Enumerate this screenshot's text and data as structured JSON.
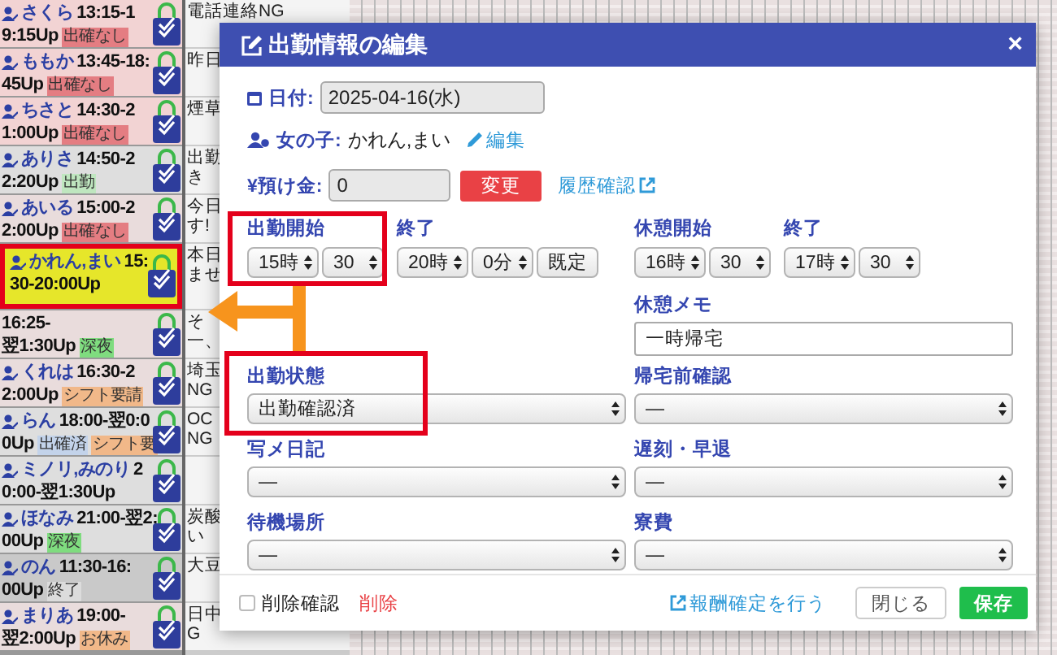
{
  "staff": [
    {
      "name": "さくら",
      "time1": "13:15-1",
      "time2": "9:15Up",
      "color": "#f2d3d3",
      "selected": false,
      "tags": [
        {
          "label": "出確なし",
          "color": "#e47d82"
        }
      ],
      "notes": [
        "電話連絡NG"
      ]
    },
    {
      "name": "ももか",
      "time1": "13:45-18:",
      "time2": "45Up",
      "color": "#f2d3d3",
      "selected": false,
      "tags": [
        {
          "label": "出確なし",
          "color": "#e47d82"
        }
      ],
      "notes": [
        "昨日"
      ]
    },
    {
      "name": "ちさと",
      "time1": "14:30-2",
      "time2": "1:00Up",
      "color": "#f2d3d3",
      "selected": false,
      "tags": [
        {
          "label": "出確なし",
          "color": "#e47d82"
        }
      ],
      "notes": [
        "煙草"
      ]
    },
    {
      "name": "ありさ",
      "time1": "14:50-2",
      "time2": "2:20Up",
      "color": "#dedede",
      "selected": false,
      "tags": [
        {
          "label": "出勤",
          "color": "#bfe6bf"
        }
      ],
      "notes": [
        "出勤",
        "き"
      ]
    },
    {
      "name": "あいる",
      "time1": "15:00-2",
      "time2": "2:00Up",
      "color": "#e9dcdc",
      "selected": false,
      "tags": [
        {
          "label": "出確なし",
          "color": "#e47d82"
        }
      ],
      "notes": [
        "今日",
        "す!"
      ]
    },
    {
      "name": "かれん,まい",
      "time1": "15:",
      "time2": "30-20:00Up",
      "color": "#e6e62a",
      "selected": true,
      "notes": [
        "本日",
        "ませ"
      ]
    },
    {
      "time1": "16:25-",
      "time2": "翌1:30Up",
      "color": "#e9dcdc",
      "selected": false,
      "tags": [
        {
          "label": "深夜",
          "color": "#7fdc7f"
        }
      ],
      "notes": [
        "そ",
        "一、"
      ]
    },
    {
      "name": "くれは",
      "time1": "16:30-2",
      "time2": "2:00Up",
      "color": "#e9dcdc",
      "selected": false,
      "tags": [
        {
          "label": "シフト要請",
          "color": "#f1b889"
        }
      ],
      "notes": [
        "埼玉",
        "NG"
      ]
    },
    {
      "name": "らん",
      "time1": "18:00-翌0:0",
      "time2": "0Up",
      "color": "#dedede",
      "selected": false,
      "tags": [
        {
          "label": "出確済",
          "color": "#c3d3ea"
        },
        {
          "label": "シフト要",
          "color": "#f1b889"
        }
      ],
      "notes": [
        "OC",
        "NG"
      ]
    },
    {
      "name": "ミノリ,みのり",
      "time1": "2",
      "time2": "0:00-翌1:30Up",
      "color": "#dedede",
      "selected": false
    },
    {
      "name": "ほなみ",
      "time1": "21:00-翌2:",
      "time2": "00Up",
      "color": "#dedede",
      "selected": false,
      "tags": [
        {
          "label": "深夜",
          "color": "#7fdc7f"
        }
      ],
      "notes": [
        "炭酸",
        "い"
      ]
    },
    {
      "name": "のん",
      "time1": "11:30-16:",
      "time2": "00Up",
      "color": "#c9c9c9",
      "selected": false,
      "tags": [
        {
          "label": "終了",
          "color": "#dcdcdc"
        }
      ],
      "notes": [
        "大豆"
      ]
    },
    {
      "name": "まりあ",
      "time1": "19:00-",
      "time2": "翌2:00Up",
      "color": "#e9dcdc",
      "selected": false,
      "tags": [
        {
          "label": "お休み",
          "color": "#f1b889"
        }
      ],
      "notes": [
        "日中",
        "G"
      ]
    }
  ],
  "modal": {
    "title": "出勤情報の編集",
    "close": "×",
    "date": {
      "label": "日付:",
      "value": "2025-04-16(水)"
    },
    "girl": {
      "label": "女の子:",
      "value": "かれん,まい",
      "edit_link": "編集"
    },
    "deposit": {
      "label": "¥預け金:",
      "value": "0",
      "button": "変更",
      "history_link": "履歴確認"
    },
    "time_groups": [
      {
        "label": "出勤開始",
        "selects": [
          "15時",
          "30"
        ]
      },
      {
        "label": "終了",
        "selects": [
          "20時",
          "0分",
          "既定"
        ]
      },
      {
        "label": "休憩開始",
        "selects": [
          "16時",
          "30"
        ]
      },
      {
        "label": "終了",
        "selects": [
          "17時",
          "30"
        ]
      }
    ],
    "break_memo": {
      "label": "休憩メモ",
      "value": "一時帰宅"
    },
    "fields": [
      {
        "label": "出勤状態",
        "value": "出勤確認済"
      },
      {
        "label": "帰宅前確認",
        "value": "—"
      },
      {
        "label": "写メ日記",
        "value": "—"
      },
      {
        "label": "遅刻・早退",
        "value": "—"
      },
      {
        "label": "待機場所",
        "value": "—"
      },
      {
        "label": "寮費",
        "value": "—"
      }
    ],
    "footer": {
      "delete_checkbox": {
        "label": "削除確認",
        "checked": false
      },
      "delete_link": "削除",
      "reward_link": "報酬確定を行う",
      "close_button": "閉じる",
      "save_button": "保存"
    }
  }
}
